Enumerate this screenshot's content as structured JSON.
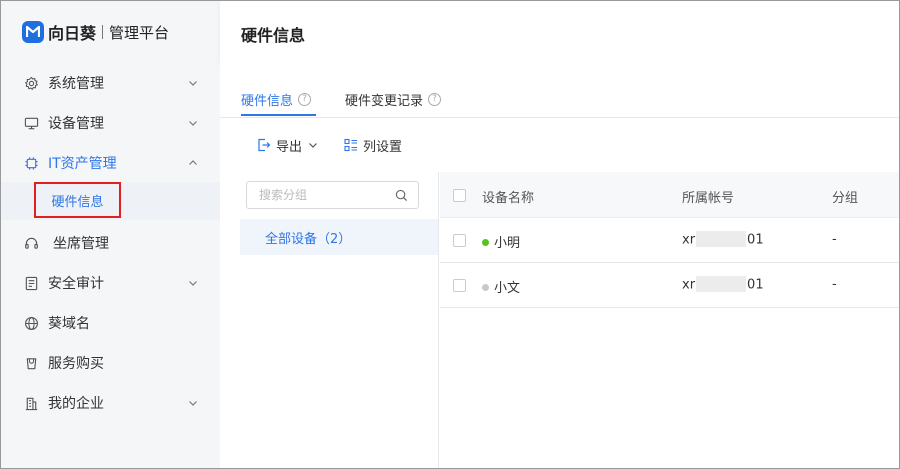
{
  "brand": {
    "name": "向日葵",
    "subtitle": "管理平台"
  },
  "sidebar": {
    "items": [
      {
        "label": "系统管理",
        "icon": "gear-icon",
        "expandable": true
      },
      {
        "label": "设备管理",
        "icon": "monitor-icon",
        "expandable": true
      },
      {
        "label": "IT资产管理",
        "icon": "chip-icon",
        "expandable": true,
        "expanded": true,
        "active": true
      },
      {
        "label": "坐席管理",
        "icon": "headset-icon",
        "expandable": false
      },
      {
        "label": "安全审计",
        "icon": "audit-icon",
        "expandable": true
      },
      {
        "label": "葵域名",
        "icon": "globe-icon",
        "expandable": false
      },
      {
        "label": "服务购买",
        "icon": "bag-icon",
        "expandable": false
      },
      {
        "label": "我的企业",
        "icon": "building-icon",
        "expandable": true
      }
    ],
    "sub_item": {
      "label": "硬件信息",
      "active": true
    }
  },
  "header": {
    "title": "硬件信息"
  },
  "tabs": [
    {
      "label": "硬件信息",
      "active": true,
      "help": "?"
    },
    {
      "label": "硬件变更记录",
      "active": false,
      "help": "?"
    }
  ],
  "toolbar": {
    "export_label": "导出",
    "columns_label": "列设置"
  },
  "groups": {
    "search_placeholder": "搜索分组",
    "all_devices_label": "全部设备（2）"
  },
  "table": {
    "columns": [
      "设备名称",
      "所属帐号",
      "分组"
    ],
    "rows": [
      {
        "name": "小明",
        "status_color": "#52c41a",
        "account_prefix": "xr",
        "account_suffix": "01",
        "group": "-"
      },
      {
        "name": "小文",
        "status_color": "#c8c8c8",
        "account_prefix": "xr",
        "account_suffix": "01",
        "group": "-"
      }
    ]
  },
  "colors": {
    "accent": "#2f76e8",
    "highlight_box": "#e02020"
  }
}
